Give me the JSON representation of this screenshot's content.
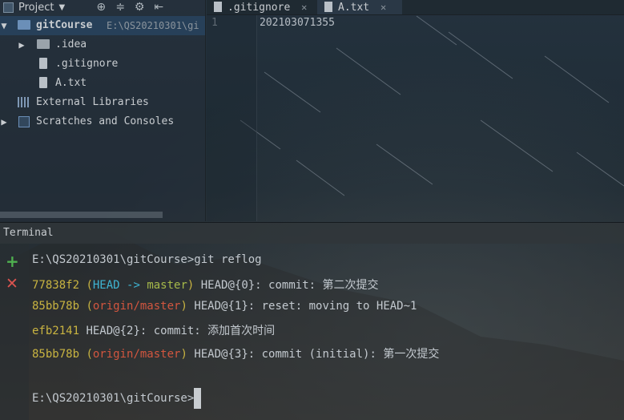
{
  "project_panel": {
    "title": "Project",
    "tree": [
      {
        "label": "gitCourse",
        "path": "E:\\QS20210301\\gi"
      },
      {
        "label": ".idea"
      },
      {
        "label": ".gitignore"
      },
      {
        "label": "A.txt"
      },
      {
        "label": "External Libraries"
      },
      {
        "label": "Scratches and Consoles"
      }
    ]
  },
  "editor": {
    "tabs": [
      {
        "label": ".gitignore"
      },
      {
        "label": "A.txt"
      }
    ],
    "line_number": "1",
    "content": "202103071355"
  },
  "terminal": {
    "title": "Terminal",
    "prompt1": "E:\\QS20210301\\gitCourse>git reflog",
    "lines": [
      {
        "hash": "77838f2",
        "open": " (",
        "head": "HEAD -> ",
        "branch": "master",
        "close": ")",
        "rest": " HEAD@{0}: commit: 第二次提交"
      },
      {
        "hash": "85bb78b",
        "open": " (",
        "branch": "origin/master",
        "close": ")",
        "rest": " HEAD@{1}: reset: moving to HEAD~1"
      },
      {
        "hash": "efb2141",
        "rest": " HEAD@{2}: commit: 添加首次时间"
      },
      {
        "hash": "85bb78b",
        "open": " (",
        "branch": "origin/master",
        "close": ")",
        "rest": " HEAD@{3}: commit (initial): 第一次提交"
      }
    ],
    "prompt2": "E:\\QS20210301\\gitCourse>"
  },
  "colors": {
    "hash": "#c9b441",
    "head": "#3fb4d2",
    "local_branch": "#a6b94a",
    "remote_branch": "#d2563f"
  }
}
